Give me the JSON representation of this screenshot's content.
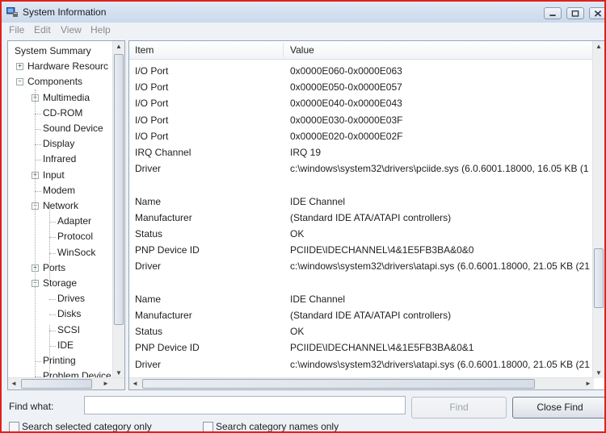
{
  "window": {
    "title": "System Information"
  },
  "menu": [
    "File",
    "Edit",
    "View",
    "Help"
  ],
  "tree": {
    "items": [
      {
        "label": "System Summary",
        "level": 0,
        "expander": ""
      },
      {
        "label": "Hardware Resourc",
        "level": 0,
        "expander": "+"
      },
      {
        "label": "Components",
        "level": 0,
        "expander": "-"
      },
      {
        "label": "Multimedia",
        "level": 1,
        "expander": "+"
      },
      {
        "label": "CD-ROM",
        "level": 1,
        "expander": ""
      },
      {
        "label": "Sound Device",
        "level": 1,
        "expander": ""
      },
      {
        "label": "Display",
        "level": 1,
        "expander": ""
      },
      {
        "label": "Infrared",
        "level": 1,
        "expander": ""
      },
      {
        "label": "Input",
        "level": 1,
        "expander": "+"
      },
      {
        "label": "Modem",
        "level": 1,
        "expander": ""
      },
      {
        "label": "Network",
        "level": 1,
        "expander": "-"
      },
      {
        "label": "Adapter",
        "level": 2,
        "expander": ""
      },
      {
        "label": "Protocol",
        "level": 2,
        "expander": ""
      },
      {
        "label": "WinSock",
        "level": 2,
        "expander": ""
      },
      {
        "label": "Ports",
        "level": 1,
        "expander": "+"
      },
      {
        "label": "Storage",
        "level": 1,
        "expander": "-"
      },
      {
        "label": "Drives",
        "level": 2,
        "expander": ""
      },
      {
        "label": "Disks",
        "level": 2,
        "expander": ""
      },
      {
        "label": "SCSI",
        "level": 2,
        "expander": ""
      },
      {
        "label": "IDE",
        "level": 2,
        "expander": ""
      },
      {
        "label": "Printing",
        "level": 1,
        "expander": ""
      },
      {
        "label": "Problem Device",
        "level": 1,
        "expander": ""
      }
    ]
  },
  "list": {
    "columns": [
      "Item",
      "Value"
    ],
    "rows": [
      [
        "I/O Port",
        "0x0000E060-0x0000E063"
      ],
      [
        "I/O Port",
        "0x0000E050-0x0000E057"
      ],
      [
        "I/O Port",
        "0x0000E040-0x0000E043"
      ],
      [
        "I/O Port",
        "0x0000E030-0x0000E03F"
      ],
      [
        "I/O Port",
        "0x0000E020-0x0000E02F"
      ],
      [
        "IRQ Channel",
        "IRQ 19"
      ],
      [
        "Driver",
        "c:\\windows\\system32\\drivers\\pciide.sys (6.0.6001.18000, 16.05 KB (1"
      ],
      [
        "",
        ""
      ],
      [
        "Name",
        "IDE Channel"
      ],
      [
        "Manufacturer",
        "(Standard IDE ATA/ATAPI controllers)"
      ],
      [
        "Status",
        "OK"
      ],
      [
        "PNP Device ID",
        "PCIIDE\\IDECHANNEL\\4&1E5FB3BA&0&0"
      ],
      [
        "Driver",
        "c:\\windows\\system32\\drivers\\atapi.sys (6.0.6001.18000, 21.05 KB (21"
      ],
      [
        "",
        ""
      ],
      [
        "Name",
        "IDE Channel"
      ],
      [
        "Manufacturer",
        "(Standard IDE ATA/ATAPI controllers)"
      ],
      [
        "Status",
        "OK"
      ],
      [
        "PNP Device ID",
        "PCIIDE\\IDECHANNEL\\4&1E5FB3BA&0&1"
      ],
      [
        "Driver",
        "c:\\windows\\system32\\drivers\\atapi.sys (6.0.6001.18000, 21.05 KB (21"
      ]
    ]
  },
  "find": {
    "label": "Find what:",
    "value": "",
    "find_button": "Find",
    "close_button": "Close Find",
    "search_selected": "Search selected category only",
    "search_names": "Search category names only"
  },
  "icons": {
    "app": "system-information-icon",
    "minimize": "minimize-icon",
    "maximize": "maximize-icon",
    "close": "close-icon"
  },
  "colors": {
    "border_accent": "#e0201c"
  }
}
